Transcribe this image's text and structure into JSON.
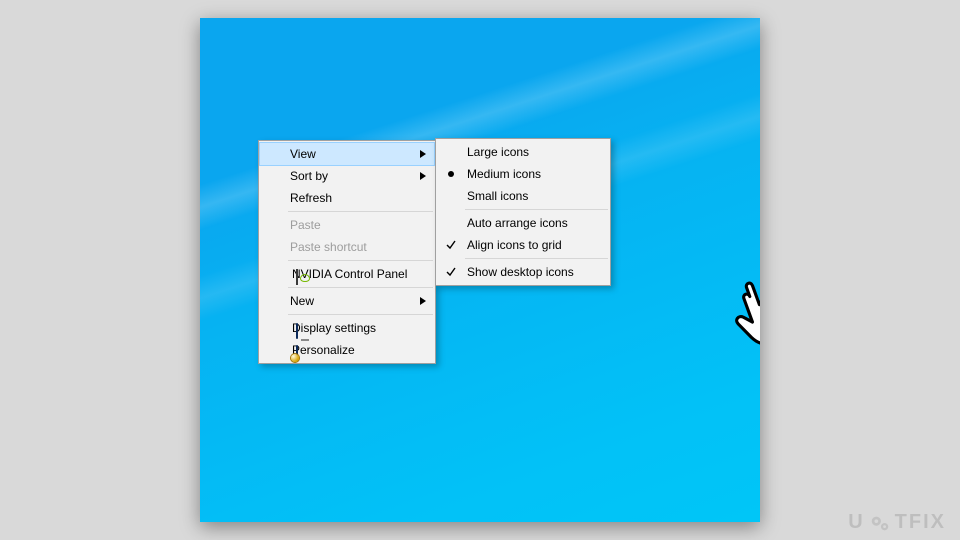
{
  "watermark": {
    "prefix": "U",
    "suffix": "TFIX"
  },
  "context_menu": {
    "view": {
      "label": "View",
      "has_submenu": true,
      "highlighted": true
    },
    "sortby": {
      "label": "Sort by",
      "has_submenu": true
    },
    "refresh": {
      "label": "Refresh"
    },
    "paste": {
      "label": "Paste",
      "enabled": false
    },
    "paste_shortcut": {
      "label": "Paste shortcut",
      "enabled": false
    },
    "nvidia": {
      "label": "NVIDIA Control Panel"
    },
    "new": {
      "label": "New",
      "has_submenu": true
    },
    "display_settings": {
      "label": "Display settings"
    },
    "personalize": {
      "label": "Personalize"
    }
  },
  "view_submenu": {
    "large": {
      "label": "Large icons"
    },
    "medium": {
      "label": "Medium icons",
      "selected": true
    },
    "small": {
      "label": "Small icons"
    },
    "auto_arrange": {
      "label": "Auto arrange icons",
      "checked": false
    },
    "align_grid": {
      "label": "Align icons to grid",
      "checked": true
    },
    "show_desktop": {
      "label": "Show desktop icons",
      "checked": true
    }
  }
}
